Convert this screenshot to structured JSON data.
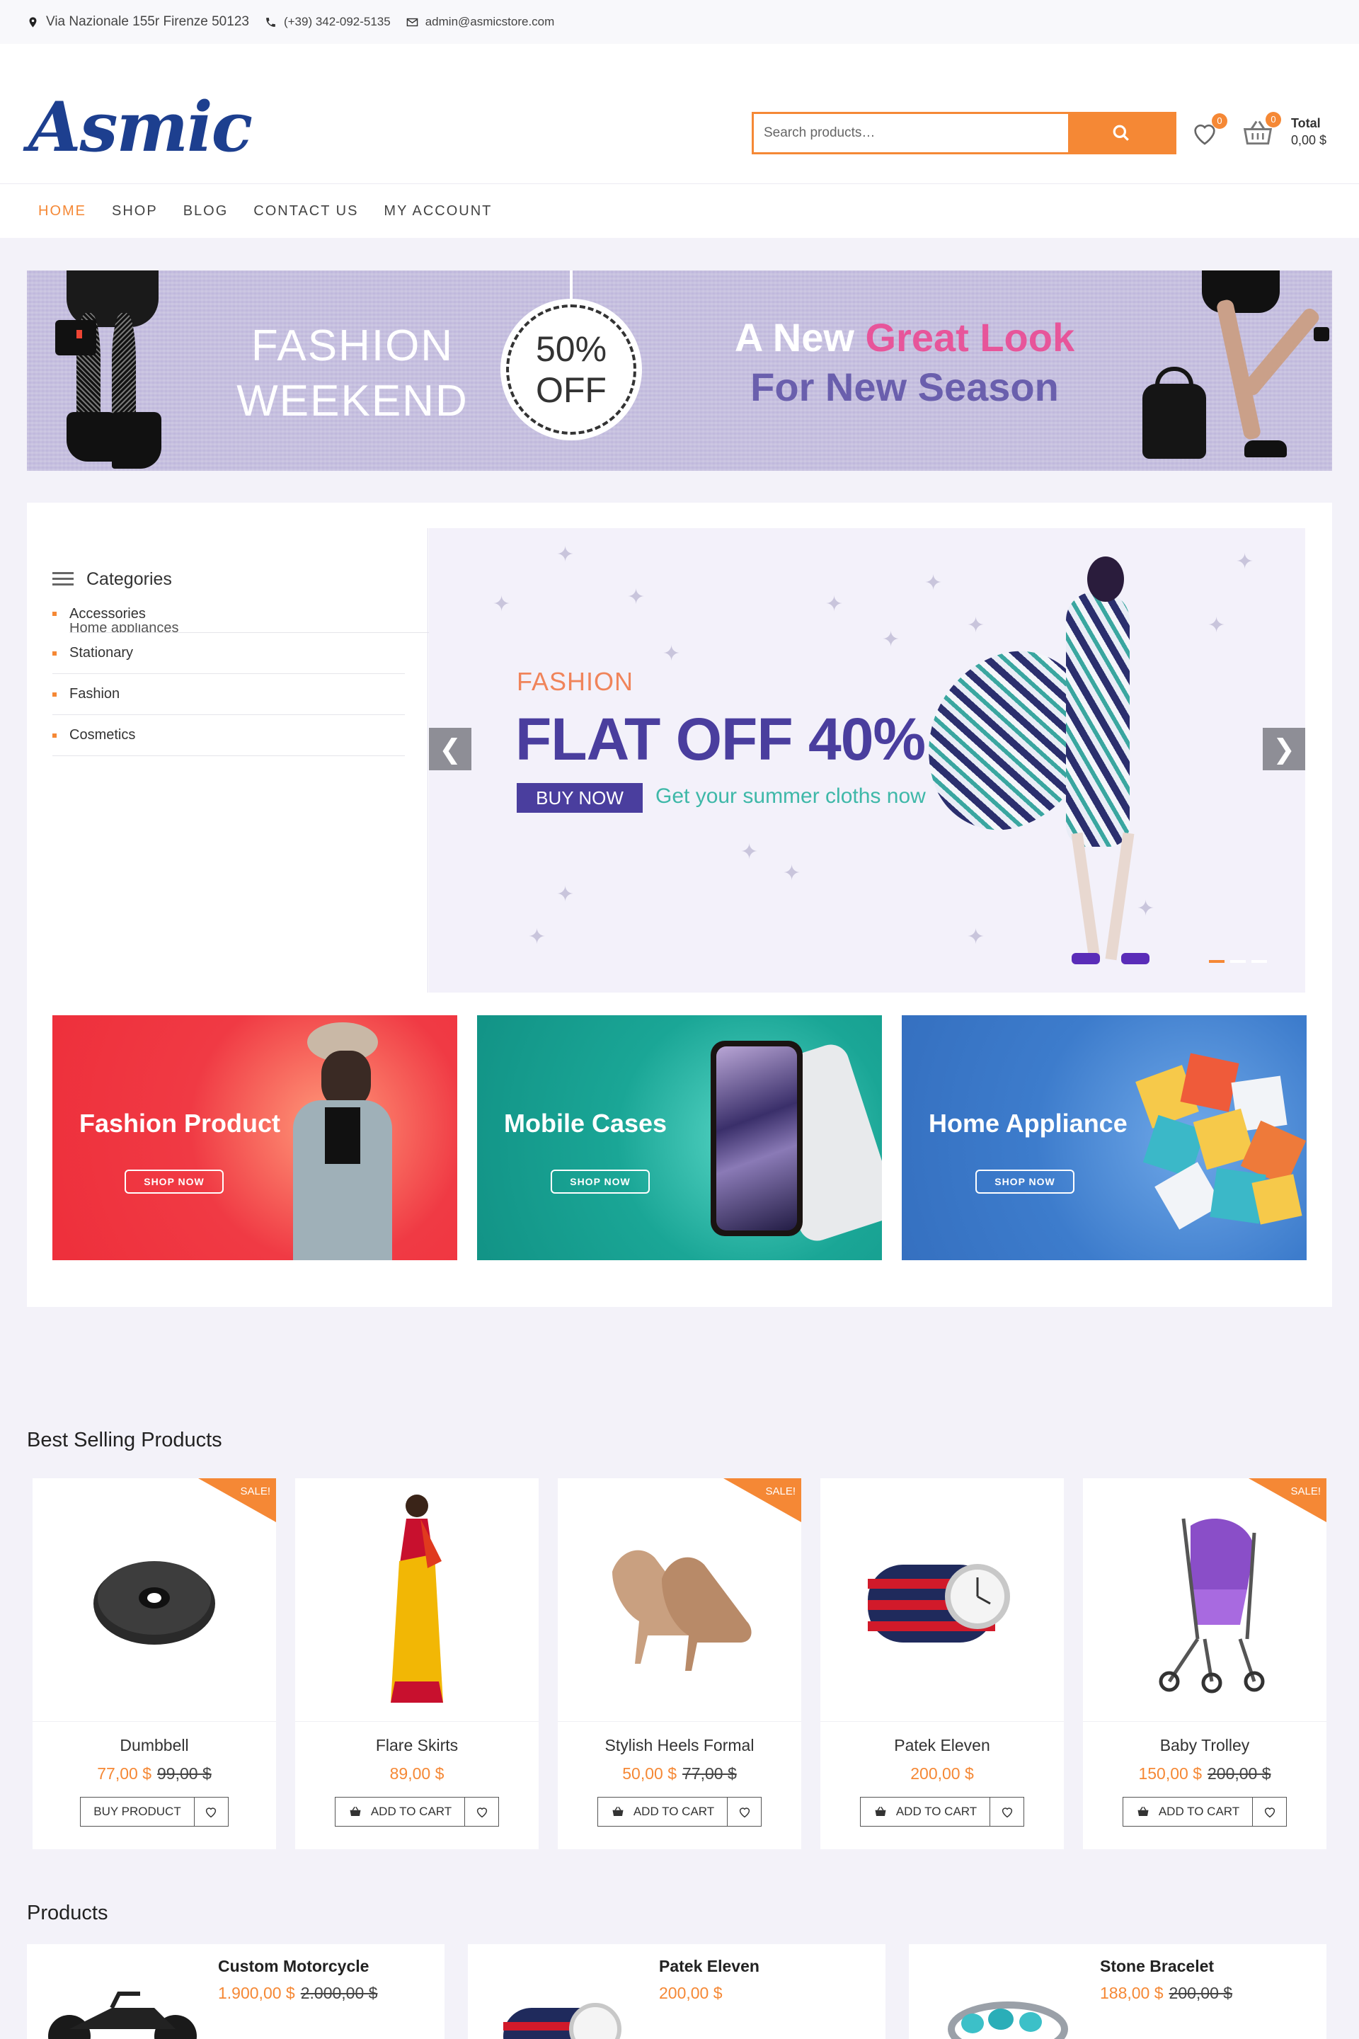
{
  "topbar": {
    "address": "Via Nazionale 155r Firenze 50123",
    "phone": "(+39) 342-092-5135",
    "email": "admin@asmicstore.com"
  },
  "header": {
    "logo": "Asmic",
    "search_placeholder": "Search products…",
    "wishlist_count": "0",
    "cart_count": "0",
    "total_label": "Total",
    "total_value": "0,00 $"
  },
  "nav": [
    {
      "label": "HOME",
      "active": true
    },
    {
      "label": "SHOP"
    },
    {
      "label": "BLOG"
    },
    {
      "label": "CONTACT US"
    },
    {
      "label": "MY ACCOUNT"
    }
  ],
  "hero": {
    "line1": "FASHION",
    "line2": "WEEKEND",
    "badge_top": "50%",
    "badge_bottom": "OFF",
    "tag_a": "A New",
    "tag_b": "Great Look",
    "tag_c": "For New Season"
  },
  "categories": {
    "title": "Categories",
    "items": [
      "Accessories",
      "Home appliances",
      "Stationary",
      "Fashion",
      "Cosmetics"
    ]
  },
  "slider": {
    "kicker": "FASHION",
    "headline": "FLAT OFF 40%",
    "button": "BUY NOW",
    "subtitle": "Get your summer cloths now",
    "prev": "❮",
    "next": "❯",
    "active_slide": 1,
    "slide_count": 3
  },
  "promos": [
    {
      "title": "Fashion Product",
      "button": "SHOP NOW"
    },
    {
      "title": "Mobile Cases",
      "button": "SHOP NOW"
    },
    {
      "title": "Home Appliance",
      "button": "SHOP NOW"
    }
  ],
  "best_selling": {
    "title": "Best Selling Products",
    "sale_label": "SALE!",
    "items": [
      {
        "name": "Dumbbell",
        "price": "77,00 $",
        "old_price": "99,00 $",
        "button": "BUY PRODUCT",
        "sale": true,
        "icon": "dumbbell-plate"
      },
      {
        "name": "Flare Skirts",
        "price": "89,00 $",
        "old_price": "",
        "button": "ADD TO CART",
        "sale": false,
        "icon": "saree"
      },
      {
        "name": "Stylish Heels Formal",
        "price": "50,00 $",
        "old_price": "77,00 $",
        "button": "ADD TO CART",
        "sale": true,
        "icon": "heels"
      },
      {
        "name": "Patek Eleven",
        "price": "200,00 $",
        "old_price": "",
        "button": "ADD TO CART",
        "sale": false,
        "icon": "watch"
      },
      {
        "name": "Baby Trolley",
        "price": "150,00 $",
        "old_price": "200,00 $",
        "button": "ADD TO CART",
        "sale": true,
        "icon": "stroller"
      }
    ]
  },
  "products": {
    "title": "Products",
    "items": [
      {
        "name": "Custom Motorcycle",
        "price": "1.900,00 $",
        "old_price": "2.000,00 $"
      },
      {
        "name": "Patek Eleven",
        "price": "200,00 $",
        "old_price": ""
      },
      {
        "name": "Stone Bracelet",
        "price": "188,00 $",
        "old_price": "200,00 $"
      }
    ]
  },
  "colors": {
    "accent": "#f58835",
    "brand": "#1d3f8f",
    "slider_headline": "#4a3e9e"
  }
}
